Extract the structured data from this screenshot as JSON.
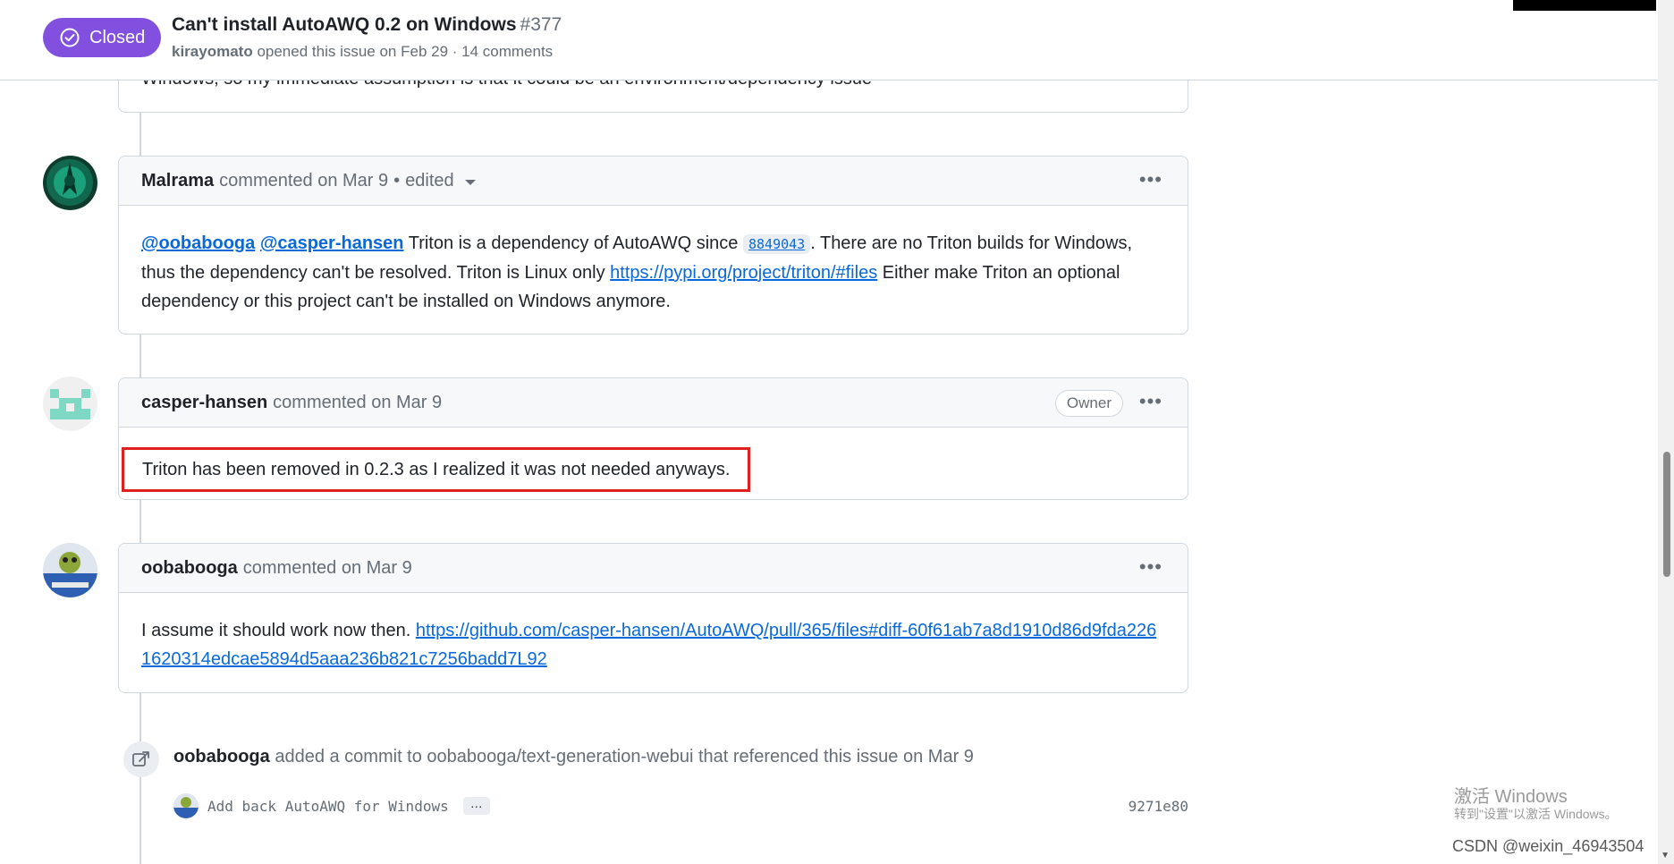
{
  "header": {
    "state": "Closed",
    "title": "Can't install AutoAWQ 0.2 on Windows",
    "number": "#377",
    "author": "kirayomato",
    "meta": "opened this issue on Feb 29 · 14 comments"
  },
  "prev_comment_tail": "Windows, so my immediate assumption is that it could be an environment/dependency issue",
  "comments": [
    {
      "author": "Malrama",
      "action": "commented on Mar 9",
      "sep": "•",
      "edited": "edited",
      "body": {
        "mention1": "@oobabooga",
        "mention2": "@casper-hansen",
        "text1": "Triton is a dependency of AutoAWQ since",
        "sha": "8849043",
        "text2": ". There are no Triton builds for Windows, thus the dependency can't be resolved. Triton is Linux only",
        "link": "https://pypi.org/project/triton/#files",
        "text3": "Either make Triton an optional dependency or this project can't be installed on Windows anymore."
      }
    },
    {
      "author": "casper-hansen",
      "action": "commented on Mar 9",
      "badge": "Owner",
      "body": "Triton has been removed in 0.2.3 as I realized it was not needed anyways."
    },
    {
      "author": "oobabooga",
      "action": "commented on Mar 9",
      "body_text": "I assume it should work now then.",
      "body_link": "https://github.com/casper-hansen/AutoAWQ/pull/365/files#diff-60f61ab7a8d1910d86d9fda2261620314edcae5894d5aaa236b821c7256badd7L92"
    }
  ],
  "event": {
    "author": "oobabooga",
    "text": "added a commit to oobabooga/text-generation-webui that referenced this issue on Mar 9",
    "commit_message": "Add back AutoAWQ for Windows",
    "commit_ellipsis": "…",
    "commit_sha": "9271e80"
  },
  "watermark": {
    "line1": "激活 Windows",
    "line2": "转到\"设置\"以激活 Windows。",
    "csdn": "CSDN @weixin_46943504"
  },
  "icons": [
    "check-circle-icon",
    "kebab-icon",
    "cross-reference-icon",
    "caret-down-icon"
  ],
  "colors": {
    "closed": "#8250df",
    "link": "#0969da",
    "highlight": "#e0201f"
  }
}
